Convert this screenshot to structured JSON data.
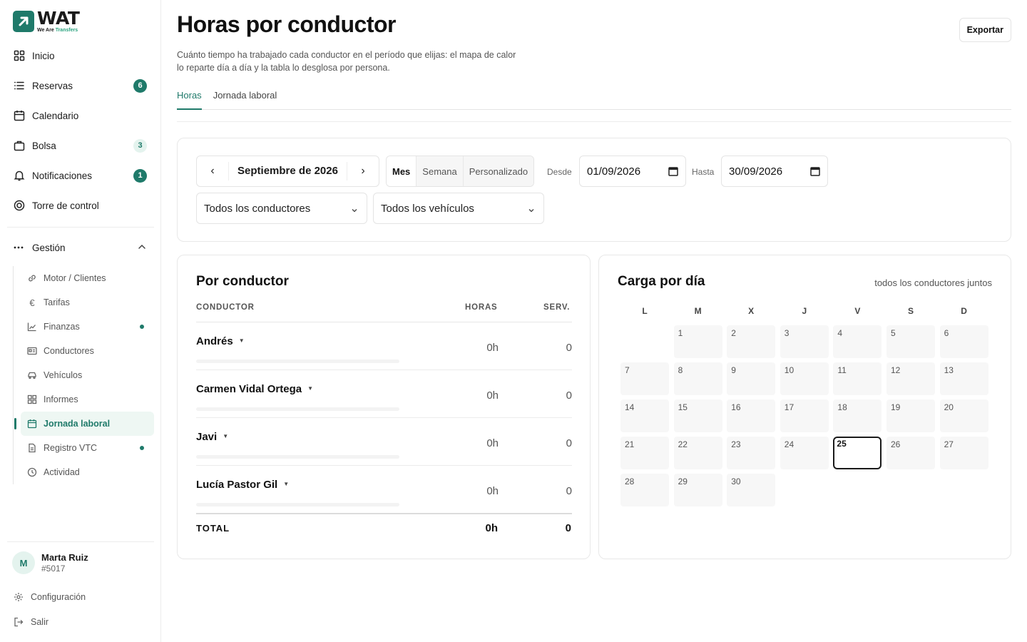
{
  "brand": {
    "name": "WAT",
    "tagline_a": "We Are",
    "tagline_b": "Transfers",
    "accent": "#1f7a6a"
  },
  "nav": [
    {
      "label": "Inicio",
      "icon": "grid-icon"
    },
    {
      "label": "Reservas",
      "icon": "list-icon",
      "badge": "6"
    },
    {
      "label": "Calendario",
      "icon": "calendar-icon"
    },
    {
      "label": "Bolsa",
      "icon": "bag-icon",
      "badge": "3"
    },
    {
      "label": "Notificaciones",
      "icon": "bell-icon",
      "badge": "1"
    },
    {
      "label": "Torre de control",
      "icon": "target-icon"
    }
  ],
  "gestion": {
    "label": "Gestión",
    "items": [
      {
        "label": "Motor / Clientes",
        "icon": "link-icon"
      },
      {
        "label": "Tarifas",
        "icon": "euro-icon"
      },
      {
        "label": "Finanzas",
        "icon": "chart-icon",
        "dot": true
      },
      {
        "label": "Conductores",
        "icon": "id-card-icon"
      },
      {
        "label": "Vehículos",
        "icon": "car-icon"
      },
      {
        "label": "Informes",
        "icon": "grid-icon"
      },
      {
        "label": "Jornada laboral",
        "icon": "calendar-icon",
        "active": true
      },
      {
        "label": "Registro VTC",
        "icon": "document-icon",
        "dot": true
      },
      {
        "label": "Actividad",
        "icon": "clock-icon"
      }
    ]
  },
  "user": {
    "initial": "M",
    "name": "Marta Ruiz",
    "id": "#5017"
  },
  "footer": {
    "settings": "Configuración",
    "logout": "Salir"
  },
  "page": {
    "title": "Horas por conductor",
    "description": "Cuánto tiempo ha trabajado cada conductor en el período que elijas: el mapa de calor lo reparte día a día y la tabla lo desglosa por persona.",
    "export": "Exportar",
    "tabs": [
      "Horas",
      "Jornada laboral"
    ]
  },
  "filters": {
    "month": "Septiembre de 2026",
    "modes": [
      "Mes",
      "Semana",
      "Personalizado"
    ],
    "from_label": "Desde",
    "from": "01/09/2026",
    "to_label": "Hasta",
    "to": "30/09/2026",
    "driver_select": "Todos los conductores",
    "vehicle_select": "Todos los vehículos"
  },
  "drivers_table": {
    "title": "Por conductor",
    "headers": {
      "driver": "CONDUCTOR",
      "hours": "HORAS",
      "services": "SERV."
    },
    "rows": [
      {
        "name": "Andrés",
        "hours": "0h",
        "services": "0"
      },
      {
        "name": "Carmen Vidal Ortega",
        "hours": "0h",
        "services": "0"
      },
      {
        "name": "Javi",
        "hours": "0h",
        "services": "0"
      },
      {
        "name": "Lucía Pastor Gil",
        "hours": "0h",
        "services": "0"
      }
    ],
    "total": {
      "label": "TOTAL",
      "hours": "0h",
      "services": "0"
    }
  },
  "heatmap": {
    "title": "Carga por día",
    "subtitle": "todos los conductores juntos",
    "weekdays": [
      "L",
      "M",
      "X",
      "J",
      "V",
      "S",
      "D"
    ],
    "first_weekday_index": 1,
    "days": 30,
    "today": 25
  }
}
